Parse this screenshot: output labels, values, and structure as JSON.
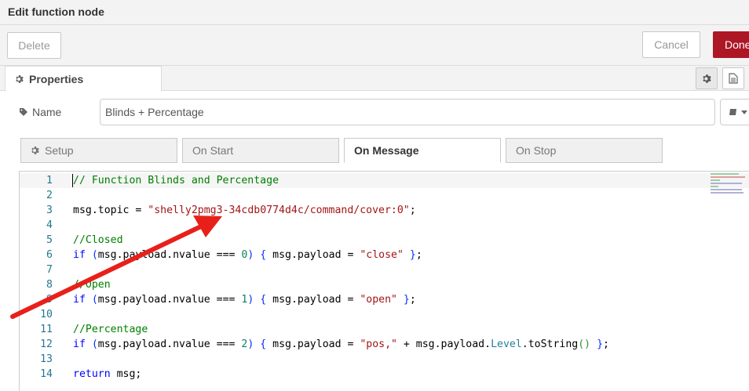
{
  "titlebar": {
    "title": "Edit function node"
  },
  "toolbar": {
    "delete_label": "Delete",
    "cancel_label": "Cancel",
    "done_label": "Done"
  },
  "tabs": {
    "properties_label": "Properties"
  },
  "name_field": {
    "label": "Name",
    "value": "Blinds + Percentage"
  },
  "subtabs": [
    {
      "label": "Setup",
      "icon": "gear-icon"
    },
    {
      "label": "On Start"
    },
    {
      "label": "On Message",
      "active": true
    },
    {
      "label": "On Stop"
    }
  ],
  "editor": {
    "lines": [
      {
        "num": "1",
        "tokens": [
          [
            "c-comment",
            "// Function Blinds and Percentage"
          ]
        ]
      },
      {
        "num": "2",
        "tokens": []
      },
      {
        "num": "3",
        "tokens": [
          [
            "",
            "msg.topic = "
          ],
          [
            "c-string",
            "\"shelly2pmg3-34cdb0774d4c/command/cover:0\""
          ],
          [
            "",
            ";"
          ]
        ]
      },
      {
        "num": "4",
        "tokens": []
      },
      {
        "num": "5",
        "tokens": [
          [
            "c-comment",
            "//Closed"
          ]
        ]
      },
      {
        "num": "6",
        "tokens": [
          [
            "c-kw",
            "if"
          ],
          [
            "",
            " "
          ],
          [
            "c-brace",
            "("
          ],
          [
            "",
            "msg.payload.nvalue === "
          ],
          [
            "c-num",
            "0"
          ],
          [
            "c-brace",
            ")"
          ],
          [
            "",
            " "
          ],
          [
            "c-brace",
            "{"
          ],
          [
            "",
            " msg.payload = "
          ],
          [
            "c-string",
            "\"close\""
          ],
          [
            "",
            " "
          ],
          [
            "c-brace",
            "}"
          ],
          [
            "",
            ";"
          ]
        ]
      },
      {
        "num": "7",
        "tokens": []
      },
      {
        "num": "8",
        "tokens": [
          [
            "c-comment",
            "//Open"
          ]
        ]
      },
      {
        "num": "9",
        "tokens": [
          [
            "c-kw",
            "if"
          ],
          [
            "",
            " "
          ],
          [
            "c-brace",
            "("
          ],
          [
            "",
            "msg.payload.nvalue === "
          ],
          [
            "c-num",
            "1"
          ],
          [
            "c-brace",
            ")"
          ],
          [
            "",
            " "
          ],
          [
            "c-brace",
            "{"
          ],
          [
            "",
            " msg.payload = "
          ],
          [
            "c-string",
            "\"open\""
          ],
          [
            "",
            " "
          ],
          [
            "c-brace",
            "}"
          ],
          [
            "",
            ";"
          ]
        ]
      },
      {
        "num": "10",
        "tokens": []
      },
      {
        "num": "11",
        "tokens": [
          [
            "c-comment",
            "//Percentage"
          ]
        ]
      },
      {
        "num": "12",
        "tokens": [
          [
            "c-kw",
            "if"
          ],
          [
            "",
            " "
          ],
          [
            "c-brace",
            "("
          ],
          [
            "",
            "msg.payload.nvalue === "
          ],
          [
            "c-num",
            "2"
          ],
          [
            "c-brace",
            ")"
          ],
          [
            "",
            " "
          ],
          [
            "c-brace",
            "{"
          ],
          [
            "",
            " msg.payload = "
          ],
          [
            "c-string",
            "\"pos,\""
          ],
          [
            "",
            " + msg.payload."
          ],
          [
            "c-prop",
            "Level"
          ],
          [
            "",
            ".toString"
          ],
          [
            "c-paren",
            "()"
          ],
          [
            "",
            " "
          ],
          [
            "c-brace",
            "}"
          ],
          [
            "",
            ";"
          ]
        ]
      },
      {
        "num": "13",
        "tokens": []
      },
      {
        "num": "14",
        "tokens": [
          [
            "c-kw",
            "return"
          ],
          [
            "",
            " msg;"
          ]
        ]
      }
    ]
  },
  "colors": {
    "done_button": "#ad1625",
    "annotation_arrow": "#e8201a"
  }
}
